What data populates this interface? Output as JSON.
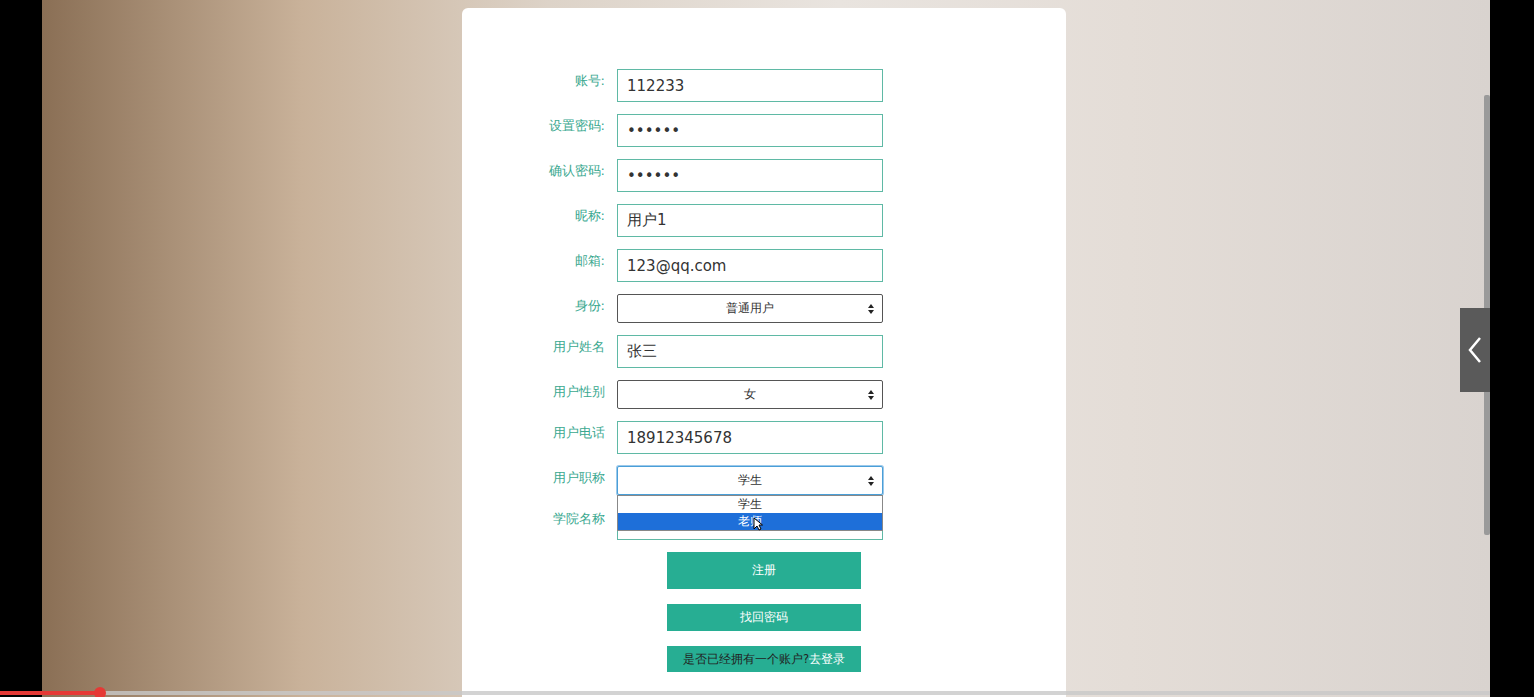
{
  "form": {
    "fields": [
      {
        "label": "账号:",
        "kind": "input",
        "value": "112233"
      },
      {
        "label": "设置密码:",
        "kind": "input",
        "value": "••••••"
      },
      {
        "label": "确认密码:",
        "kind": "input",
        "value": "••••••"
      },
      {
        "label": "昵称:",
        "kind": "input",
        "value": "用户1"
      },
      {
        "label": "邮箱:",
        "kind": "input",
        "value": "123@qq.com"
      },
      {
        "label": "身份:",
        "kind": "select",
        "value": "普通用户",
        "expanded": false
      },
      {
        "label": "用户姓名",
        "kind": "input",
        "value": "张三"
      },
      {
        "label": "用户性别",
        "kind": "select",
        "value": "女",
        "expanded": false
      },
      {
        "label": "用户电话",
        "kind": "input",
        "value": "18912345678"
      },
      {
        "label": "用户职称",
        "kind": "select",
        "value": "学生",
        "expanded": true,
        "options": [
          {
            "label": "学生",
            "selected": false
          },
          {
            "label": "老师",
            "selected": true
          }
        ]
      },
      {
        "label": "学院名称",
        "kind": "placeholder",
        "placeholder": "学院名称"
      }
    ]
  },
  "buttons": [
    "注册",
    "找回密码"
  ],
  "login_prompt": {
    "text": "是否已经拥有一个账户?",
    "link": "去登录"
  },
  "video_progress": {
    "level": 0.067
  }
}
